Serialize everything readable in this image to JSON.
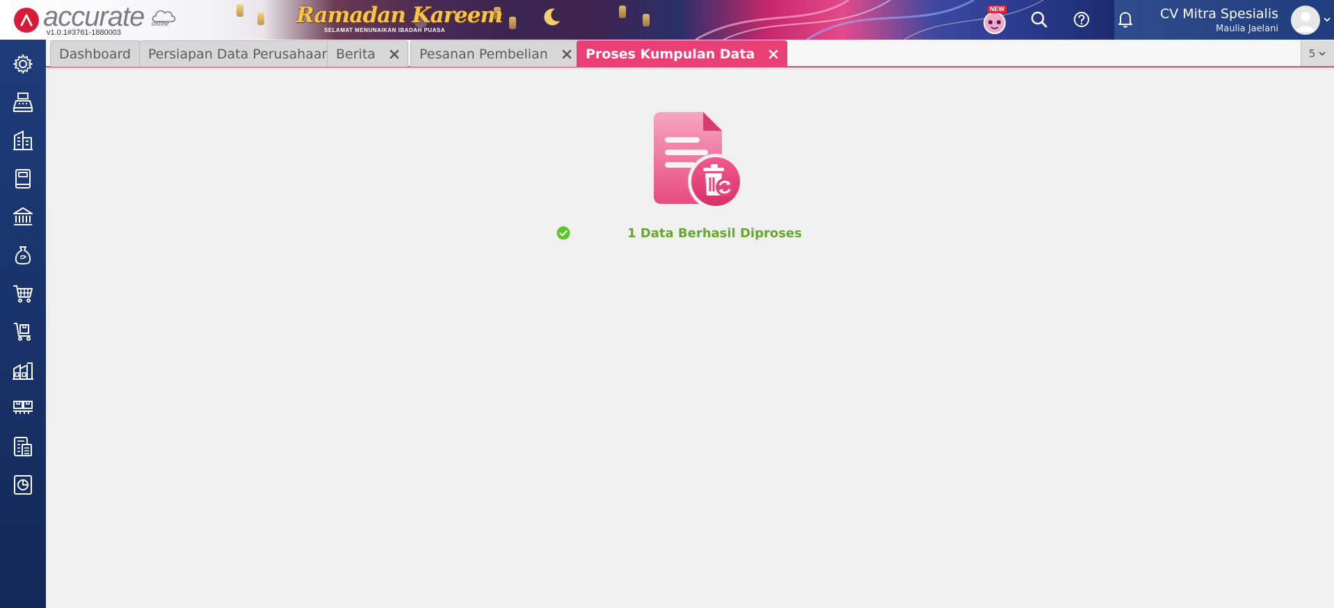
{
  "app": {
    "brand": "accurate",
    "brand_sub": "online",
    "version": "v1.0.1#3761-1880003"
  },
  "banner": {
    "title": "Ramadan Kareem",
    "subtitle": "SELAMAT MENUNAIKAN IBADAH PUASA"
  },
  "header": {
    "new_badge": "NEW",
    "company_name": "CV Mitra Spesialis",
    "user_name": "Maulia Jaelani"
  },
  "sidebar": {
    "items": [
      {
        "icon": "gear-icon"
      },
      {
        "icon": "cash-register-icon"
      },
      {
        "icon": "company-building-icon"
      },
      {
        "icon": "ledger-book-icon"
      },
      {
        "icon": "bank-icon"
      },
      {
        "icon": "money-bag-icon"
      },
      {
        "icon": "shopping-cart-icon"
      },
      {
        "icon": "delivery-cart-icon"
      },
      {
        "icon": "warehouse-icon"
      },
      {
        "icon": "inventory-icon"
      },
      {
        "icon": "tax-icon"
      },
      {
        "icon": "report-chart-icon"
      }
    ]
  },
  "tabs": [
    {
      "label": "Dashboard",
      "closable": false,
      "active": false
    },
    {
      "label": "Persiapan Data Perusahaan",
      "closable": false,
      "active": false
    },
    {
      "label": "Berita",
      "closable": true,
      "active": false
    },
    {
      "label": "Pesanan Pembelian",
      "closable": true,
      "active": false
    },
    {
      "label": "Proses Kumpulan Data",
      "closable": true,
      "active": true
    }
  ],
  "tab_overflow": {
    "count": "5"
  },
  "content": {
    "result_message": "1 Data Berhasil Diproses"
  },
  "colors": {
    "accent": "#ea3f76",
    "success": "#67a92e",
    "sidebar": "#1d3c7a"
  }
}
